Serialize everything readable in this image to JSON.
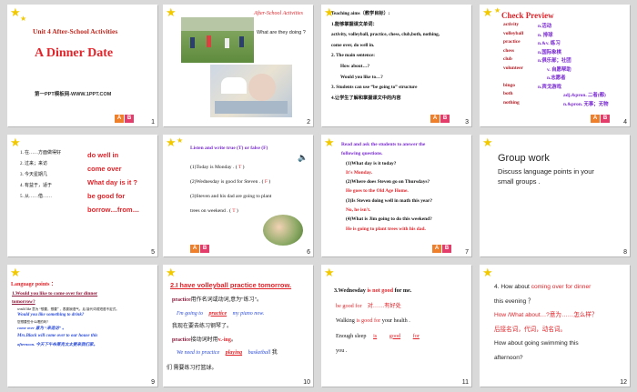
{
  "s1": {
    "num": "1",
    "unit": "Unit 4 After-School Activities",
    "title": "A Dinner Date",
    "footer": "第一PPT模板网-WWW.1PPT.COM"
  },
  "s2": {
    "num": "2",
    "title": "After-School Activities",
    "question": "What are they doing ?"
  },
  "s3": {
    "num": "3",
    "aims": "Teaching aims（教学目标）:",
    "l1": "1.能够掌握课文单词：",
    "l2": "activity, volleyball, practice, chess, club,both, nothing,",
    "l3": "come over, do well in.",
    "l4": "2. The main sentence:",
    "l5": "How about…?",
    "l6": "Would you like to…?",
    "l7": "3. Students can use “be going to” structure",
    "l8": "4.让学生了解和掌握课文中的内容"
  },
  "s4": {
    "num": "4",
    "title": "Check Preview",
    "rows": [
      {
        "w": "activity",
        "m": "n.活动"
      },
      {
        "w": "volleyball",
        "m": "n. 排球"
      },
      {
        "w": "practice",
        "m": "n.&v. 练习"
      },
      {
        "w": "chess",
        "m": "n.国际象棋"
      },
      {
        "w": "club",
        "m": "n.俱乐部；社团"
      },
      {
        "w": "volunteer",
        "m": "v. 自愿帮助"
      },
      {
        "w": "",
        "m": "n.志愿者"
      },
      {
        "w": "bingo",
        "m": "n.宾戈游戏"
      },
      {
        "w": "both",
        "m": "adj.&pron. 二者(都)"
      },
      {
        "w": "nothing",
        "m": "n.&pron. 无事；无物"
      }
    ]
  },
  "s5": {
    "num": "5",
    "left": [
      "1. 在……方面做得好",
      "2. 过来；来访",
      "3. 今天星期几",
      "4. 有益于，适于",
      "5. 从……借……"
    ],
    "right": [
      "do well in",
      "come over",
      "What day is it ?",
      "be good for",
      "borrow…from…"
    ]
  },
  "s6": {
    "num": "6",
    "title": "Listen and write true (T) or false (F)",
    "l1": "(1)Today is Monday .",
    "a1": "T",
    "l2": "(2)Wednesday is  good for Steven .",
    "a2": "F",
    "l3": "(3)Steven and his dad are going to plant",
    "l4": "trees on weekend .",
    "a4": "T"
  },
  "s7": {
    "num": "7",
    "title1": "Read and ask the students to answer the",
    "title2": "following questions.",
    "q1": "(1)What day is it today?",
    "a1": "It's Monday.",
    "q2": "(2)Where does Steven go on Thursdays?",
    "a2": "He goes to the Old Age Home.",
    "q3": "(3)Is Steven doing well in math this year?",
    "a3": "No, he isn't.",
    "q4": "(4)What is Jim going to do this weekend?",
    "a4": "He is going to plant trees with his dad."
  },
  "s8": {
    "num": "8",
    "title": "Group  work",
    "desc1": "Discuss language points  in your",
    "desc2": "small groups ."
  },
  "s9": {
    "num": "9",
    "title": "Language   points ：",
    "q1a": "1.Would you like to come over for dinner",
    "q1b": "tomorrow?",
    "n1": "would like 意为 “想要，想要” ，表委婉语气。后    接代词或短语不定式。",
    "e1": "Would you like something to drink?",
    "n2": "您想要些什么喝的吗?",
    "e2": "come over 意为 “来造访” 。",
    "e3": "Mrs.Black will come over to our house this",
    "e4": "afternoon. 今天下午布莱克太太要来我们家。"
  },
  "s10": {
    "num": "10",
    "h": "2.I have volleyball practice tomorrow.",
    "l1a": "practice",
    "l1b": "用作名词或动词,意为\"练习\"。",
    "l2a": "I'm going to",
    "l2b": "practice",
    "l2c": "my piano now.",
    "l3": "我现在要去练习钢琴了。",
    "l4a": "practice",
    "l4b": "接动词时用",
    "l4c": "v.-ing",
    "l4d": "。",
    "l5a": "We need to practice",
    "l5b": "playing",
    "l5c": "basketball",
    "l5d": "我",
    "l6": "们  需要练习打篮球。"
  },
  "s11": {
    "num": "11",
    "l1a": "3.Wednesday",
    "l1b": "is not",
    "l1c": "good",
    "l1d": "for me.",
    "l2a": "be good  for",
    "l2b": "对……有好处",
    "l3a": "Walking",
    "l3b": "is good for",
    "l3c": "your health .",
    "l4a": "Enough  sleep",
    "l4b": "is",
    "l4c": "good",
    "l4d": "for",
    "l5": "you ."
  },
  "s12": {
    "num": "12",
    "l1a": "4. How about",
    "l1b": "coming over for dinner",
    "l2": "this evening ？",
    "l3a": "How /What about…?",
    "l3b": "意为……怎么样？",
    "l4": "后接名词，代词，动名词。",
    "l5": "How about going swimming this",
    "l6": "afternoon?"
  },
  "ab": {
    "a": "A",
    "b": "B"
  }
}
